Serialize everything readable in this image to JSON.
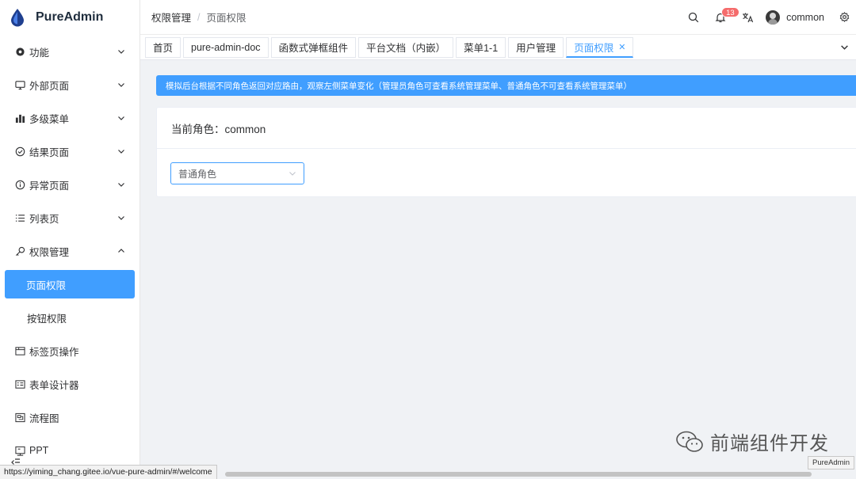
{
  "app": {
    "name": "PureAdmin"
  },
  "sidebar": {
    "items": [
      {
        "label": "功能",
        "icon": "gear-icon",
        "expanded": false
      },
      {
        "label": "外部页面",
        "icon": "monitor-icon",
        "expanded": false
      },
      {
        "label": "多级菜单",
        "icon": "bar-chart-icon",
        "expanded": false
      },
      {
        "label": "结果页面",
        "icon": "check-circle-icon",
        "expanded": false
      },
      {
        "label": "异常页面",
        "icon": "info-circle-icon",
        "expanded": false
      },
      {
        "label": "列表页",
        "icon": "list-icon",
        "expanded": false
      },
      {
        "label": "权限管理",
        "icon": "key-icon",
        "expanded": true
      }
    ],
    "submenu": [
      {
        "label": "页面权限",
        "active": true
      },
      {
        "label": "按钮权限",
        "active": false
      }
    ],
    "items_after": [
      {
        "label": "标签页操作",
        "icon": "tab-icon"
      },
      {
        "label": "表单设计器",
        "icon": "form-icon"
      },
      {
        "label": "流程图",
        "icon": "flowchart-icon"
      },
      {
        "label": "PPT",
        "icon": "ppt-icon"
      }
    ]
  },
  "header": {
    "breadcrumb": [
      "权限管理",
      "页面权限"
    ],
    "notification_count": "13",
    "username": "common"
  },
  "tabs": [
    {
      "label": "首页",
      "active": false
    },
    {
      "label": "pure-admin-doc",
      "active": false
    },
    {
      "label": "函数式弹框组件",
      "active": false
    },
    {
      "label": "平台文档（内嵌）",
      "active": false
    },
    {
      "label": "菜单1-1",
      "active": false
    },
    {
      "label": "用户管理",
      "active": false
    },
    {
      "label": "页面权限",
      "active": true
    }
  ],
  "main": {
    "alert": "模拟后台根据不同角色返回对应路由，观察左侧菜单变化（管理员角色可查看系统管理菜单、普通角色不可查看系统管理菜单）",
    "card_title": "当前角色：common",
    "role_select": "普通角色"
  },
  "watermark": {
    "text": "前端组件开发"
  },
  "tooltip": "PureAdmin",
  "statusbar": "https://yiming_chang.gitee.io/vue-pure-admin/#/welcome",
  "colors": {
    "primary": "#409eff",
    "badge": "#f56c6c"
  }
}
